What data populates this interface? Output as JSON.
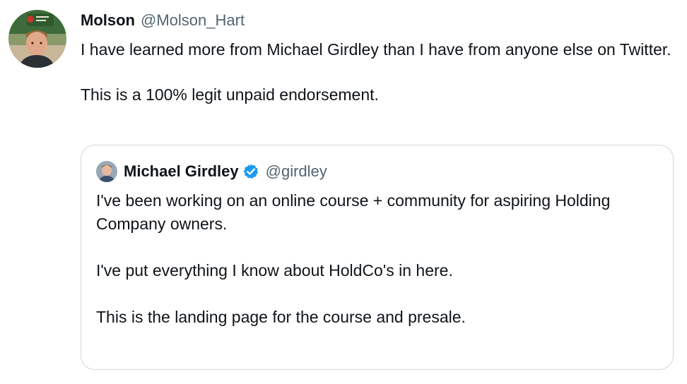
{
  "tweet": {
    "author": {
      "display_name": "Molson",
      "handle": "@Molson_Hart",
      "avatar_sign_text": "Hub Group"
    },
    "paragraphs": [
      "I have learned more from Michael Girdley than I have from anyone else on Twitter.",
      "This is a 100% legit unpaid endorsement."
    ],
    "quote": {
      "author": {
        "display_name": "Michael Girdley",
        "handle": "@girdley",
        "verified_icon": "verified-badge-icon"
      },
      "paragraphs": [
        "I've been working on an online course + community for aspiring Holding Company owners.",
        "I've put everything I know about HoldCo's in here.",
        "This is the landing page for the course and presale."
      ]
    }
  },
  "colors": {
    "text_primary": "#0f1419",
    "text_secondary": "#536471",
    "border": "#cfd9de",
    "verified_blue": "#1d9bf0"
  }
}
